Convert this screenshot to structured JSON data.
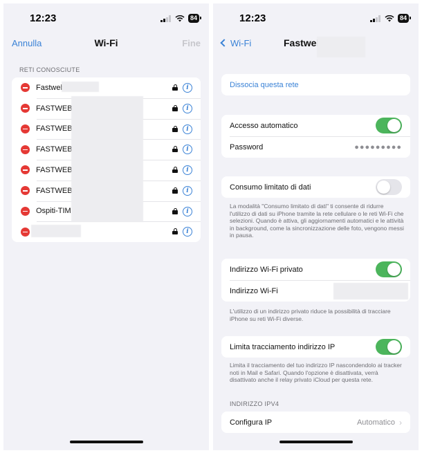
{
  "status_bar": {
    "time": "12:23",
    "battery": "84"
  },
  "left": {
    "nav": {
      "cancel": "Annulla",
      "title": "Wi-Fi",
      "done": "Fine"
    },
    "known_header": "RETI CONOSCIUTE",
    "networks": [
      {
        "name": "Fastweb"
      },
      {
        "name": "FASTWEB"
      },
      {
        "name": "FASTWEB"
      },
      {
        "name": "FASTWEB"
      },
      {
        "name": "FASTWEB"
      },
      {
        "name": "FASTWEB"
      },
      {
        "name": "Ospiti-TIM"
      },
      {
        "name": ""
      }
    ]
  },
  "right": {
    "nav": {
      "back": "Wi-Fi",
      "title": "Fastweb"
    },
    "forget": "Dissocia questa rete",
    "auto_join": {
      "label": "Accesso automatico",
      "on": true
    },
    "password": {
      "label": "Password",
      "value": "●●●●●●●●●"
    },
    "low_data": {
      "label": "Consumo limitato di dati",
      "on": false
    },
    "low_data_note": "La modalità \"Consumo limitato di dati\" ti consente di ridurre l'utilizzo di dati su iPhone tramite la rete cellulare o le reti Wi-Fi che selezioni. Quando è attiva, gli aggiornamenti automatici e le attività in background, come la sincronizzazione delle foto, vengono messi in pausa.",
    "private_addr": {
      "label": "Indirizzo Wi-Fi privato",
      "on": true
    },
    "wifi_addr": {
      "label": "Indirizzo Wi-Fi"
    },
    "private_note": "L'utilizzo di un indirizzo privato riduce la possibilità di tracciare iPhone su reti Wi-Fi diverse.",
    "limit_tracking": {
      "label": "Limita tracciamento indirizzo IP",
      "on": true
    },
    "limit_note": "Limita il tracciamento del tuo indirizzo IP nascondendolo ai tracker noti in Mail e Safari. Quando l'opzione è disattivata, verrà disattivato anche il relay privato iCloud per questa rete.",
    "ipv4_header": "INDIRIZZO IPV4",
    "configure_ip": {
      "label": "Configura IP",
      "value": "Automatico"
    }
  },
  "colors": {
    "accent": "#3a82d6",
    "toggle_on": "#4cb55c",
    "delete": "#e53935"
  },
  "icons": [
    "signal-icon",
    "wifi-icon",
    "battery-icon",
    "remove-icon",
    "lock-icon",
    "info-icon",
    "back-chevron-icon",
    "chevron-right-icon"
  ]
}
